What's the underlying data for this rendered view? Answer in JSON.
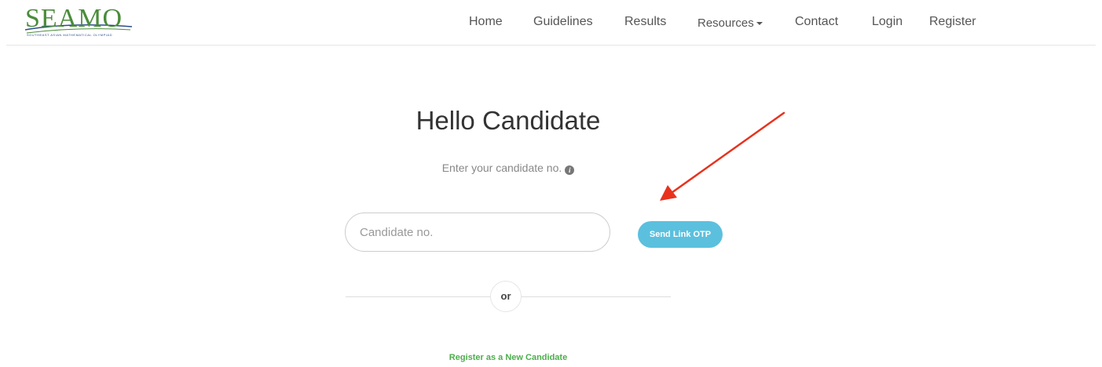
{
  "brand": {
    "logo_text": "SEAMO",
    "tagline": "Southeast Asian Mathematical Olympiad",
    "green": "#4a8c3a",
    "blue": "#2b4c8c"
  },
  "nav": {
    "items": [
      {
        "label": "Home"
      },
      {
        "label": "Guidelines"
      },
      {
        "label": "Results"
      },
      {
        "label": "Resources"
      },
      {
        "label": "Contact"
      },
      {
        "label": "Login"
      },
      {
        "label": "Register"
      }
    ],
    "resources_icon": "caret-down-icon"
  },
  "main": {
    "title": "Hello Candidate",
    "subtitle": "Enter your candidate no.",
    "info_icon": "info-circle-icon",
    "info_glyph": "i",
    "input": {
      "placeholder": "Candidate no.",
      "value": ""
    },
    "otp_button_label": "Send Link OTP",
    "otp_button_color": "#5bc0de",
    "or_label": "or",
    "register_link": "Register as a New Candidate",
    "register_link_color": "#4cae4c"
  },
  "annotation": {
    "arrow_color": "#e8321e",
    "arrow_icon": "red-arrow-annotation-icon"
  }
}
